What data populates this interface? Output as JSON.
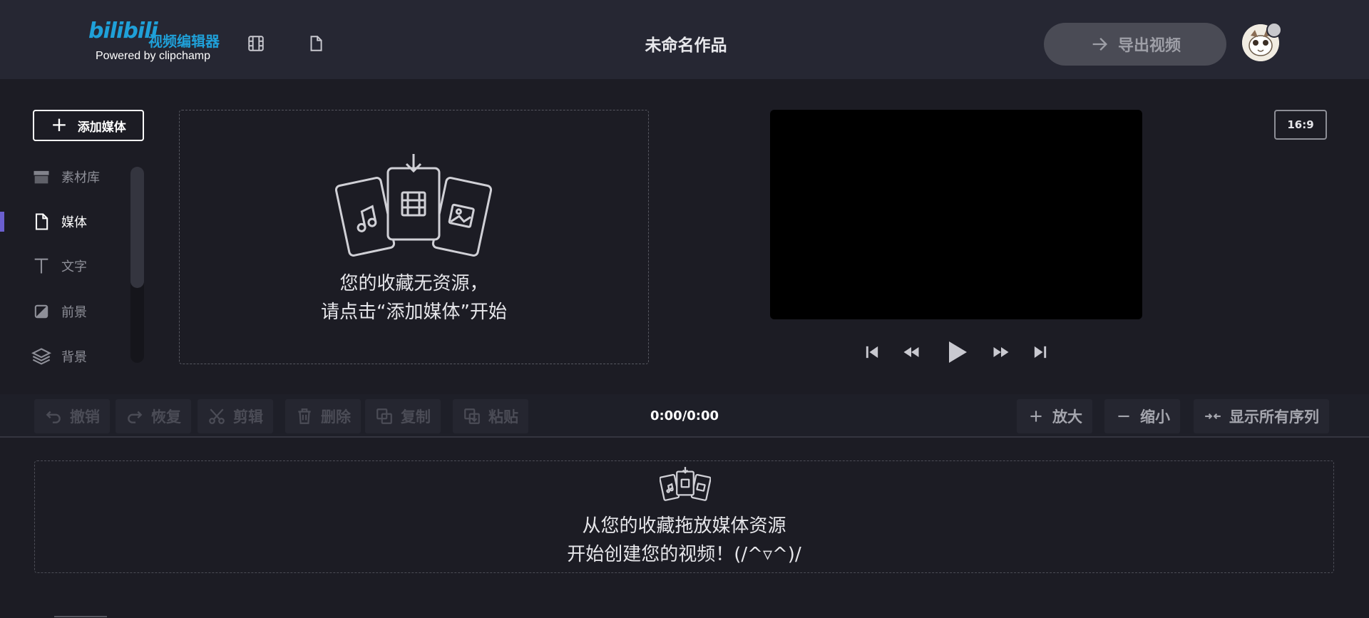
{
  "header": {
    "logo_brand": "bilibili",
    "logo_product": "视频编辑器",
    "logo_powered": "Powered by clipchamp",
    "project_title": "未命名作品",
    "export_label": "导出视频"
  },
  "sidebar": {
    "add_media_label": "添加媒体",
    "items": [
      {
        "label": "素材库",
        "icon": "store-icon"
      },
      {
        "label": "媒体",
        "icon": "file-icon",
        "active": true
      },
      {
        "label": "文字",
        "icon": "text-icon"
      },
      {
        "label": "前景",
        "icon": "foreground-icon"
      },
      {
        "label": "背景",
        "icon": "layers-icon"
      }
    ]
  },
  "media_panel": {
    "line1": "您的收藏无资源，",
    "line2": "请点击“添加媒体”开始"
  },
  "preview": {
    "aspect_ratio": "16:9"
  },
  "toolbar": {
    "undo": "撤销",
    "redo": "恢复",
    "cut": "剪辑",
    "delete": "删除",
    "copy": "复制",
    "paste": "粘贴",
    "time": "0:00/0:00",
    "zoom_in": "放大",
    "zoom_out": "缩小",
    "fit": "显示所有序列"
  },
  "timeline": {
    "line1": "从您的收藏拖放媒体资源",
    "line2": "开始创建您的视频！(/^▿^)/"
  },
  "colors": {
    "brand": "#1fa0d8",
    "accent": "#6b5fcf",
    "background": "#1c1c24"
  }
}
